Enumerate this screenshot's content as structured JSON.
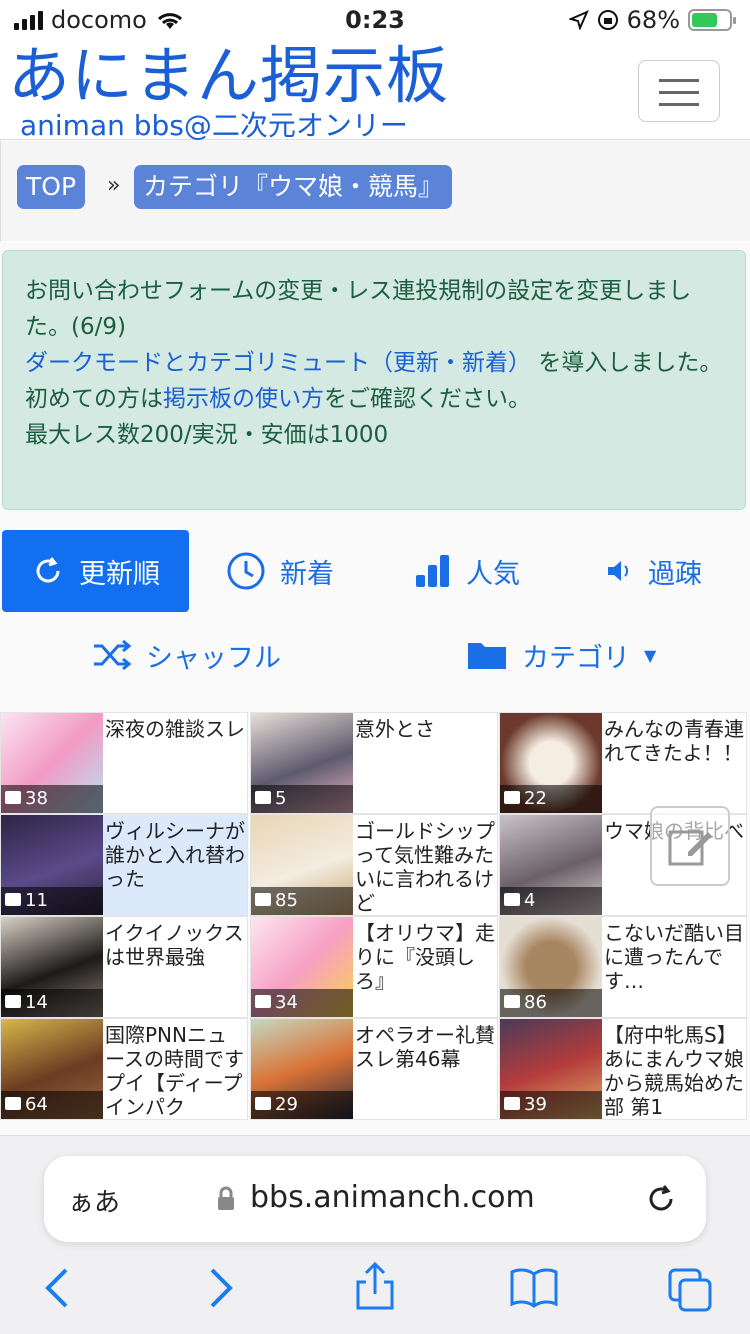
{
  "status": {
    "carrier": "docomo",
    "time": "0:23",
    "battery": "68%"
  },
  "header": {
    "logo": "あにまん掲示板",
    "sublogo": "animan bbs@二次元オンリー"
  },
  "breadcrumb": {
    "top": "TOP",
    "sep": "»",
    "category": "カテゴリ『ウマ娘・競馬』"
  },
  "notice": {
    "line1": "お問い合わせフォームの変更・レス連投規制の設定を変更しました。(6/9)",
    "link1": "ダークモードとカテゴリミュート（更新・新着）",
    "line2a": "を導入しました。",
    "line3a": "初めての方は",
    "link2": "掲示板の使い方",
    "line3b": "をご確認ください。",
    "line4": "最大レス数200/実況・安価は1000"
  },
  "tabs": [
    {
      "label": "更新順"
    },
    {
      "label": "新着"
    },
    {
      "label": "人気"
    },
    {
      "label": "過疎"
    }
  ],
  "subnav": {
    "shuffle": "シャッフル",
    "category": "カテゴリ"
  },
  "threads": [
    {
      "title": "深夜の雑談スレ",
      "count": "38"
    },
    {
      "title": "意外とさ",
      "count": "5"
    },
    {
      "title": "みんなの青春連れてきたよ！！",
      "count": "22"
    },
    {
      "title": "ヴィルシーナが誰かと入れ替わった",
      "count": "11"
    },
    {
      "title": "ゴールドシップって気性難みたいに言われるけど",
      "count": "85"
    },
    {
      "title": "ウマ娘の背比べ",
      "count": "4"
    },
    {
      "title": "イクイノックスは世界最強",
      "count": "14"
    },
    {
      "title": "【オリウマ】走りに『没頭しろ』",
      "count": "34"
    },
    {
      "title": "こないだ酷い目に遭ったんです…",
      "count": "86"
    },
    {
      "title": "国際PNNニュースの時間ですプイ【ディープインパク",
      "count": "64"
    },
    {
      "title": "オペラオー礼賛スレ第46幕",
      "count": "29"
    },
    {
      "title": "【府中牝馬S】あにまんウマ娘から競馬始めた部 第1",
      "count": "39"
    }
  ],
  "urlbar": {
    "aa": "ぁあ",
    "url": "bbs.animanch.com"
  },
  "colors": {
    "brand": "#1a5fd6",
    "active_tab": "#1270f0",
    "notice_bg": "#d3e9e1"
  }
}
